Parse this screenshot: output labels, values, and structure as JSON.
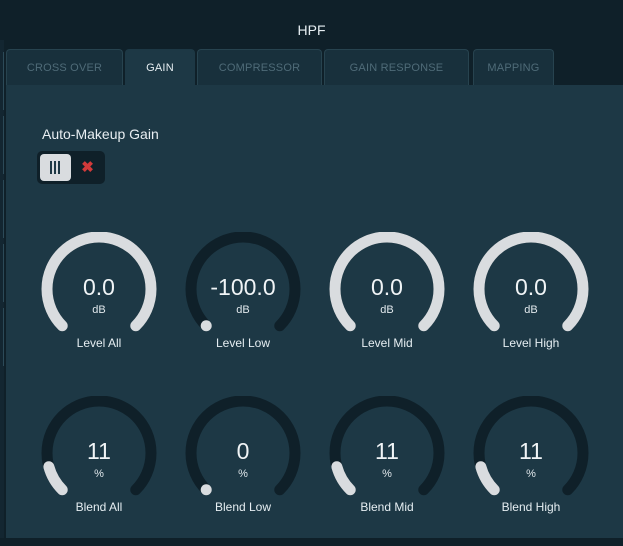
{
  "window": {
    "title": "HPF"
  },
  "tabs": [
    {
      "label": "CROSS OVER",
      "active": false
    },
    {
      "label": "GAIN",
      "active": true
    },
    {
      "label": "COMPRESSOR",
      "active": false
    },
    {
      "label": "GAIN RESPONSE",
      "active": false
    },
    {
      "label": "MAPPING",
      "active": false
    }
  ],
  "auto_makeup": {
    "label": "Auto-Makeup Gain",
    "state": "on",
    "on_icon": "bars-icon",
    "off_icon": "x-icon",
    "off_symbol": "✖"
  },
  "level_knobs": [
    {
      "value": "0.0",
      "unit": "dB",
      "label": "Level All",
      "fraction": 1.0
    },
    {
      "value": "-100.0",
      "unit": "dB",
      "label": "Level Low",
      "fraction": 0.0
    },
    {
      "value": "0.0",
      "unit": "dB",
      "label": "Level Mid",
      "fraction": 1.0
    },
    {
      "value": "0.0",
      "unit": "dB",
      "label": "Level High",
      "fraction": 1.0
    }
  ],
  "blend_knobs": [
    {
      "value": "11",
      "unit": "%",
      "label": "Blend All",
      "fraction": 0.11
    },
    {
      "value": "0",
      "unit": "%",
      "label": "Blend Low",
      "fraction": 0.0
    },
    {
      "value": "11",
      "unit": "%",
      "label": "Blend Mid",
      "fraction": 0.11
    },
    {
      "value": "11",
      "unit": "%",
      "label": "Blend High",
      "fraction": 0.11
    }
  ],
  "colors": {
    "track": "#0f2029",
    "arc": "#d9dcdf",
    "panel": "#1d3845",
    "background": "#0f2029",
    "off_accent": "#d23a3a"
  }
}
